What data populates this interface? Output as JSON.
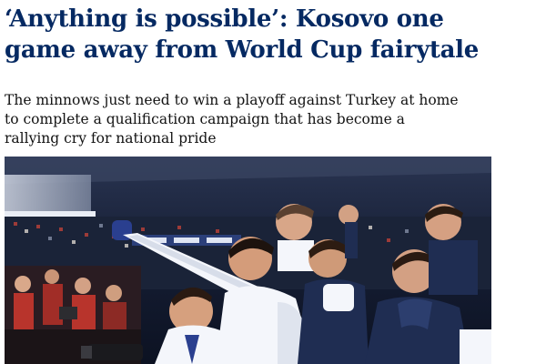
{
  "article": {
    "headline": "‘Anything is possible’: Kosovo one game away from World Cup fairytale",
    "standfirst": "The minnows just need to win a playoff against Turkey at home to complete a qualification campaign that has become a rallying cry for national pride"
  },
  "image": {
    "subject": "Kosovo players celebrating in a stadium",
    "colors": {
      "kit_white": "#f4f6fb",
      "kit_navy": "#1f2d52",
      "crowd_red": "#b8342c",
      "stadium_dark": "#10182c"
    }
  }
}
